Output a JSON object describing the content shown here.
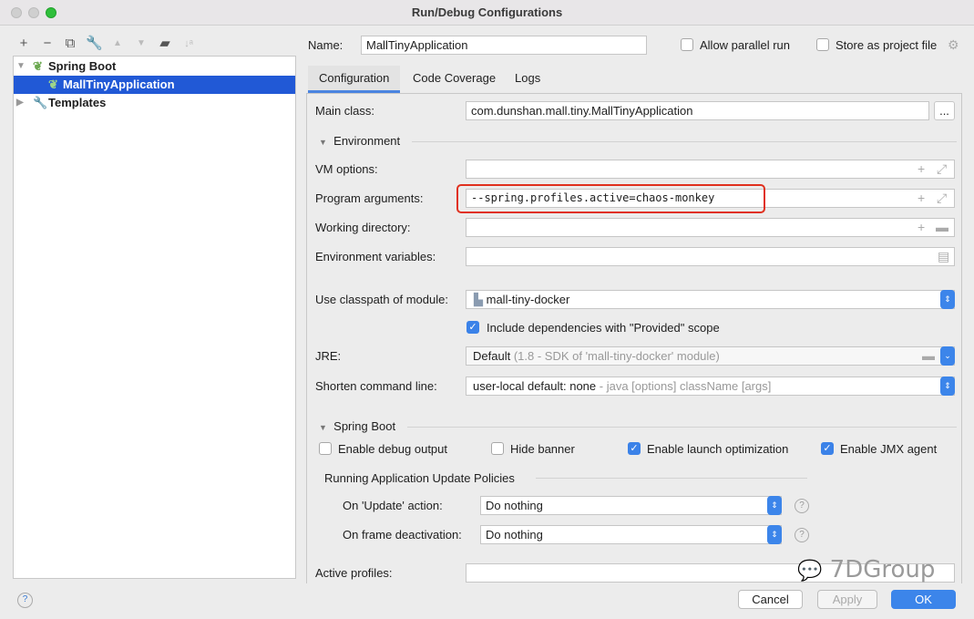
{
  "window": {
    "title": "Run/Debug Configurations"
  },
  "tree": {
    "items": [
      {
        "label": "Spring Boot"
      },
      {
        "label": "MallTinyApplication"
      },
      {
        "label": "Templates"
      }
    ]
  },
  "header": {
    "name_label": "Name:",
    "name_value": "MallTinyApplication",
    "allow_parallel": "Allow parallel run",
    "store_project": "Store as project file"
  },
  "tabs": [
    {
      "label": "Configuration"
    },
    {
      "label": "Code Coverage"
    },
    {
      "label": "Logs"
    }
  ],
  "form": {
    "main_class_label": "Main class:",
    "main_class": "com.dunshan.mall.tiny.MallTinyApplication",
    "browse": "...",
    "environment": "Environment",
    "vm_label": "VM options:",
    "vm_value": "",
    "args_label": "Program arguments:",
    "args_value": "--spring.profiles.active=chaos-monkey",
    "workdir_label": "Working directory:",
    "env_label": "Environment variables:",
    "classpath_label": "Use classpath of module:",
    "classpath_value": "mall-tiny-docker",
    "include_deps": "Include dependencies with \"Provided\" scope",
    "jre_label": "JRE:",
    "jre_value": "Default",
    "jre_hint": "(1.8 - SDK of 'mall-tiny-docker' module)",
    "shorten_label": "Shorten command line:",
    "shorten_value": "user-local default: none",
    "shorten_hint": "- java [options] className [args]",
    "spring_boot": "Spring Boot",
    "debug_output": "Enable debug output",
    "hide_banner": "Hide banner",
    "launch_opt": "Enable launch optimization",
    "jmx": "Enable JMX agent",
    "policies": "Running Application Update Policies",
    "update_label": "On 'Update' action:",
    "update_value": "Do nothing",
    "frame_label": "On frame deactivation:",
    "frame_value": "Do nothing",
    "profiles_label": "Active profiles:"
  },
  "checks": {
    "allow_parallel": false,
    "store_project": false,
    "include_deps": true,
    "debug_output": false,
    "hide_banner": false,
    "launch_opt": true,
    "jmx": true
  },
  "footer": {
    "help": "?",
    "cancel": "Cancel",
    "apply": "Apply",
    "ok": "OK"
  },
  "watermark": "7DGroup",
  "colors": {
    "accent": "#2159d6",
    "highlight_box": "#e0301e"
  }
}
